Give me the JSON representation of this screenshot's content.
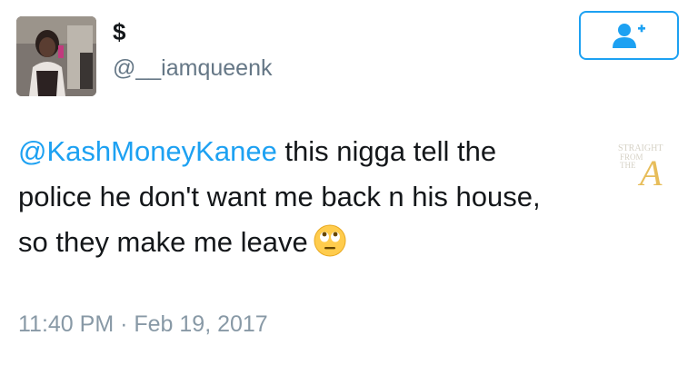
{
  "author": {
    "display_name": "$",
    "handle": "@__iamqueenk"
  },
  "follow_button": {
    "icon": "add-user-icon",
    "color": "#1da1f2"
  },
  "tweet": {
    "mention": "@KashMoneyKanee",
    "line1_rest": " this nigga tell the",
    "line2": "police he don't want me back n his house,",
    "line3": "so they make me leave",
    "emoji": "eye-roll-emoji"
  },
  "watermark": {
    "line1": "STRAIGHT",
    "line2": "FROM",
    "line3": "THE",
    "letter": "A"
  },
  "timestamp": "11:40 PM · Feb 19, 2017",
  "colors": {
    "link": "#1da1f2",
    "secondary": "#657786",
    "muted": "#8899a6"
  }
}
